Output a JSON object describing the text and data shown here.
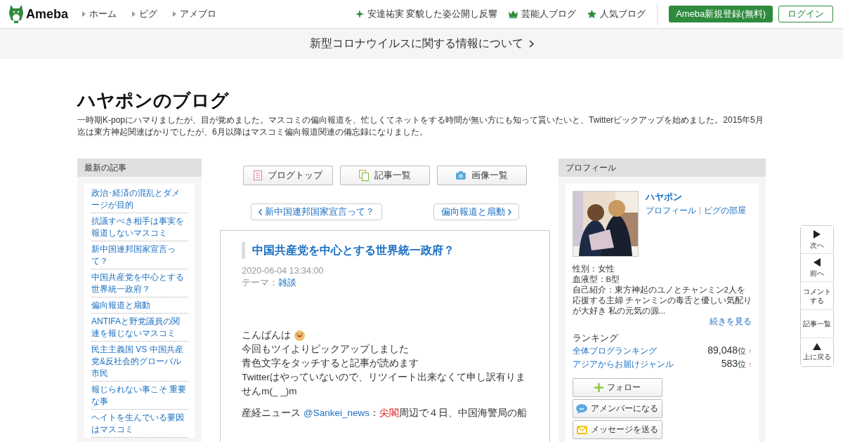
{
  "header": {
    "logo": "Ameba",
    "nav": [
      "ホーム",
      "ピグ",
      "アメブロ"
    ],
    "links": [
      {
        "kind": "news",
        "label": "安達祐実 変貌した姿公開し反響"
      },
      {
        "kind": "crown",
        "label": "芸能人ブログ"
      },
      {
        "kind": "star",
        "label": "人気ブログ"
      }
    ],
    "register": "Ameba新規登録(無料)",
    "login": "ログイン"
  },
  "banner": {
    "label": "新型コロナウイルスに関する情報について"
  },
  "blog": {
    "title": "ハヤポンのブログ",
    "description": "一時期K-popにハマりましたが、目が覚めました。マスコミの偏向報道を、忙しくてネットをする時間が無い方にも知って貰いたいと、Twitterピックアップを始めました。2015年5月迄は東方神起関連ばかりでしたが、6月以降はマスコミ偏向報道関連の備忘録になりました。"
  },
  "recent": {
    "heading": "最新の記事",
    "items": [
      "政治･経済の混乱とダメージが目的",
      "抗議すべき相手は事実を報道しないマスコミ",
      "新中国連邦国家宣言って？",
      "中国共産党を中心とする世界統一政府？",
      "偏向報道と扇動",
      "ANTIFAと野党議員の関連を報じないマスコミ",
      "民主主義国 VS 中国共産党&反社会的グローバル市民",
      "報じられない事こそ 重要な事",
      "ヘイトを生んでいる要因はマスコミ"
    ]
  },
  "menu_buttons": [
    {
      "kind": "doc",
      "label": "ブログトップ"
    },
    {
      "kind": "pages",
      "label": "記事一覧"
    },
    {
      "kind": "camera",
      "label": "画像一覧"
    }
  ],
  "pager": {
    "prev": "新中国連邦国家宣言って？",
    "next": "偏向報道と扇動"
  },
  "article": {
    "title": "中国共産党を中心とする世界統一政府？",
    "date": "2020-06-04 13:34:00",
    "theme_label": "テーマ：",
    "theme": "雑談",
    "greeting": "こんばんは",
    "lines": [
      "今回もツイよりピックアップしました",
      "青色文字をタッチすると記事が読めます",
      "Twitterはやっていないので、リツイート出来なくて申し訳有りませんm(_ _)m"
    ],
    "last_line": [
      {
        "kind": "text",
        "text": "産経ニュース "
      },
      {
        "kind": "link",
        "text": "@Sankei_news"
      },
      {
        "kind": "text",
        "text": "："
      },
      {
        "kind": "hot",
        "text": "尖閣"
      },
      {
        "kind": "text",
        "text": "周辺で４日、中国海警局の船"
      }
    ]
  },
  "profile": {
    "heading": "プロフィール",
    "name": "ハヤポン",
    "links": [
      "プロフィール",
      "ピグの部屋"
    ],
    "details": [
      "性別：女性",
      "血液型：B型"
    ],
    "intro": "自己紹介：東方神起のユノとチャンミン2人を応援する主婦 チャンミンの毒舌と優しい気配りが大好き 私の元気の源...",
    "more": "続きを見る",
    "ranking_heading": "ランキング",
    "rankings": [
      {
        "label": "全体ブログランキング",
        "rank": "89,048",
        "unit": "位",
        "arrow": "↑"
      },
      {
        "label": "アジアからお届けジャンル",
        "rank": "583",
        "unit": "位",
        "arrow": "↑"
      }
    ],
    "buttons": [
      {
        "kind": "follow",
        "label": "フォロー"
      },
      {
        "kind": "amember",
        "label": "アメンバーになる"
      },
      {
        "kind": "message",
        "label": "メッセージを送る"
      }
    ]
  },
  "side_nav": [
    {
      "kind": "next",
      "label": "次へ"
    },
    {
      "kind": "prev",
      "label": "前へ"
    },
    {
      "kind": "comment",
      "label": "コメントする"
    },
    {
      "kind": "list",
      "label": "記事一覧"
    },
    {
      "kind": "top",
      "label": "上に戻る"
    }
  ]
}
